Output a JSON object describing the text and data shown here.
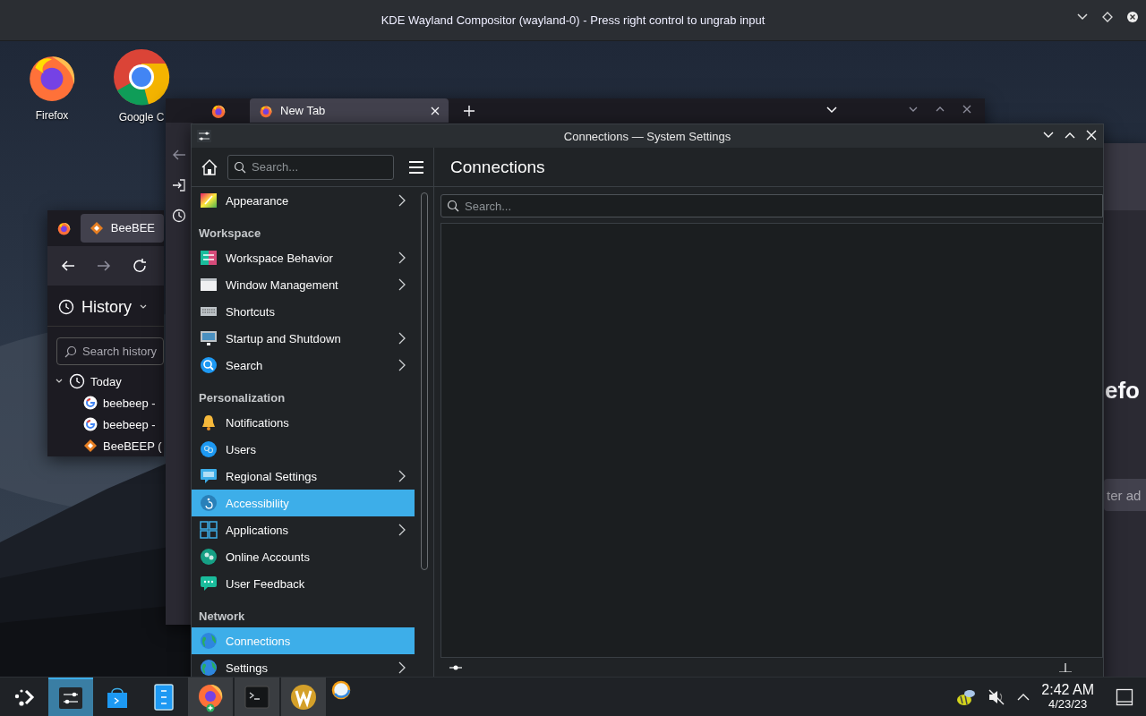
{
  "host_window": {
    "title": "KDE Wayland Compositor (wayland-0) - Press right control to ungrab input"
  },
  "desktop_icons": [
    {
      "label": "Firefox",
      "kind": "firefox"
    },
    {
      "label": "Google C",
      "kind": "chrome"
    }
  ],
  "firefox_right": {
    "brand_fragment": "efo",
    "address_fragment": "ter ad"
  },
  "firefox_back": {
    "tabs": [
      {
        "label": "New Tab",
        "selected": true
      }
    ]
  },
  "firefox_history": {
    "tabs": [
      {
        "label": "BeeBEE",
        "selected": true
      }
    ],
    "sidebar_title": "History",
    "search": {
      "placeholder": "Search history"
    },
    "tree": [
      {
        "label": "Today",
        "expanded": true,
        "children": [
          {
            "label": "beebeep -",
            "kind": "google"
          },
          {
            "label": "beebeep -",
            "kind": "google"
          },
          {
            "label": "BeeBEEP (",
            "kind": "beebeep"
          }
        ]
      }
    ]
  },
  "settings_window": {
    "title": "Connections — System Settings",
    "search": {
      "placeholder": "Search..."
    },
    "sidebar": [
      {
        "kind": "item",
        "label": "Appearance",
        "submenu": true,
        "selected": false
      },
      {
        "kind": "heading",
        "label": "Workspace"
      },
      {
        "kind": "item",
        "label": "Workspace Behavior",
        "submenu": true,
        "selected": false
      },
      {
        "kind": "item",
        "label": "Window Management",
        "submenu": true,
        "selected": false
      },
      {
        "kind": "item",
        "label": "Shortcuts",
        "submenu": false,
        "selected": false
      },
      {
        "kind": "item",
        "label": "Startup and Shutdown",
        "submenu": true,
        "selected": false
      },
      {
        "kind": "item",
        "label": "Search",
        "submenu": true,
        "selected": false
      },
      {
        "kind": "heading",
        "label": "Personalization"
      },
      {
        "kind": "item",
        "label": "Notifications",
        "submenu": false,
        "selected": false
      },
      {
        "kind": "item",
        "label": "Users",
        "submenu": false,
        "selected": false
      },
      {
        "kind": "item",
        "label": "Regional Settings",
        "submenu": true,
        "selected": false
      },
      {
        "kind": "item",
        "label": "Accessibility",
        "submenu": false,
        "selected": true
      },
      {
        "kind": "item",
        "label": "Applications",
        "submenu": true,
        "selected": false
      },
      {
        "kind": "item",
        "label": "Online Accounts",
        "submenu": false,
        "selected": false
      },
      {
        "kind": "item",
        "label": "User Feedback",
        "submenu": false,
        "selected": false
      },
      {
        "kind": "heading",
        "label": "Network"
      },
      {
        "kind": "item",
        "label": "Connections",
        "submenu": false,
        "selected": true
      },
      {
        "kind": "item",
        "label": "Settings",
        "submenu": true,
        "selected": false
      }
    ],
    "page_title": "Connections",
    "page_search": {
      "placeholder": "Search..."
    }
  },
  "taskbar": {
    "apps": [
      {
        "kind": "launcher",
        "selected": false,
        "running": false
      },
      {
        "kind": "settings",
        "selected": true,
        "running": true
      },
      {
        "kind": "discover",
        "selected": false,
        "running": false
      },
      {
        "kind": "files",
        "selected": false,
        "running": false
      },
      {
        "kind": "firefox",
        "selected": false,
        "running": true
      },
      {
        "kind": "terminal",
        "selected": false,
        "running": true
      },
      {
        "kind": "w-app",
        "selected": false,
        "running": true
      },
      {
        "kind": "ring",
        "selected": false,
        "running": false
      }
    ],
    "clock": {
      "time": "2:42 AM",
      "date": "4/23/23"
    }
  }
}
